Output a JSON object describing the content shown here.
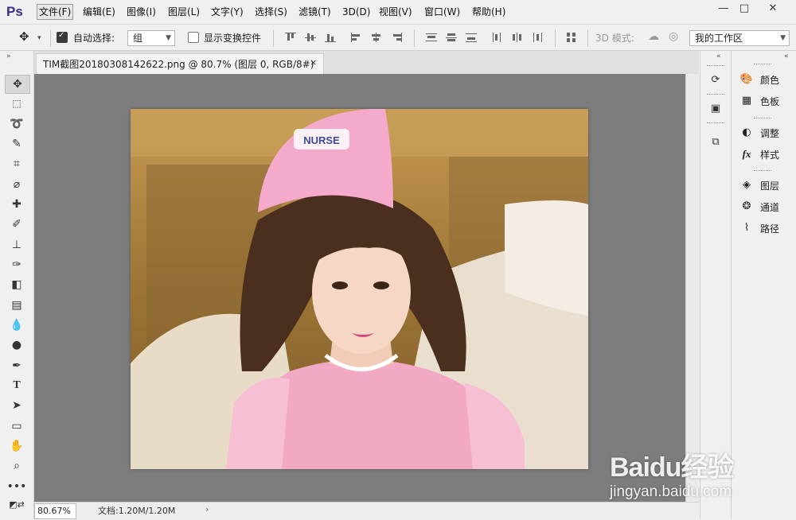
{
  "app": {
    "logo": "Ps"
  },
  "menu": [
    {
      "label": "文件(F)",
      "active": true
    },
    {
      "label": "编辑(E)"
    },
    {
      "label": "图像(I)"
    },
    {
      "label": "图层(L)"
    },
    {
      "label": "文字(Y)"
    },
    {
      "label": "选择(S)"
    },
    {
      "label": "滤镜(T)"
    },
    {
      "label": "3D(D)"
    },
    {
      "label": "视图(V)"
    },
    {
      "label": "窗口(W)"
    },
    {
      "label": "帮助(H)"
    }
  ],
  "window_controls": {
    "minimize": "—",
    "restore": "□",
    "close": "✕"
  },
  "options": {
    "auto_select_label": "自动选择:",
    "auto_select_checked": true,
    "auto_select_value": "组",
    "show_transform_label": "显示变换控件",
    "show_transform_checked": false,
    "mode_3d_label": "3D 模式:",
    "workspace_value": "我的工作区"
  },
  "document": {
    "tab_title": "TIM截图20180308142622.png @ 80.7% (图层 0, RGB/8#)",
    "close_glyph": "×"
  },
  "status": {
    "zoom": "80.67%",
    "doc_size": "文档:1.20M/1.20M",
    "arrow": "›"
  },
  "panels": [
    {
      "icon": "palette-icon",
      "glyph": "🎨",
      "label": "颜色"
    },
    {
      "icon": "swatches-icon",
      "glyph": "▦",
      "label": "色板"
    },
    {
      "icon": "adjustments-icon",
      "glyph": "◐",
      "label": "调整"
    },
    {
      "icon": "styles-icon",
      "glyph": "fx",
      "label": "样式"
    },
    {
      "icon": "layers-icon",
      "glyph": "◈",
      "label": "图层"
    },
    {
      "icon": "channels-icon",
      "glyph": "❂",
      "label": "通道"
    },
    {
      "icon": "paths-icon",
      "glyph": "⌇",
      "label": "路径"
    }
  ],
  "watermark": {
    "brand": "Baidu经验",
    "url": "jingyan.baidu.com"
  },
  "colors": {
    "canvas_bg": "#7d7d7d",
    "ui_bg": "#f0f0f0",
    "logo": "#3a2d8c"
  }
}
